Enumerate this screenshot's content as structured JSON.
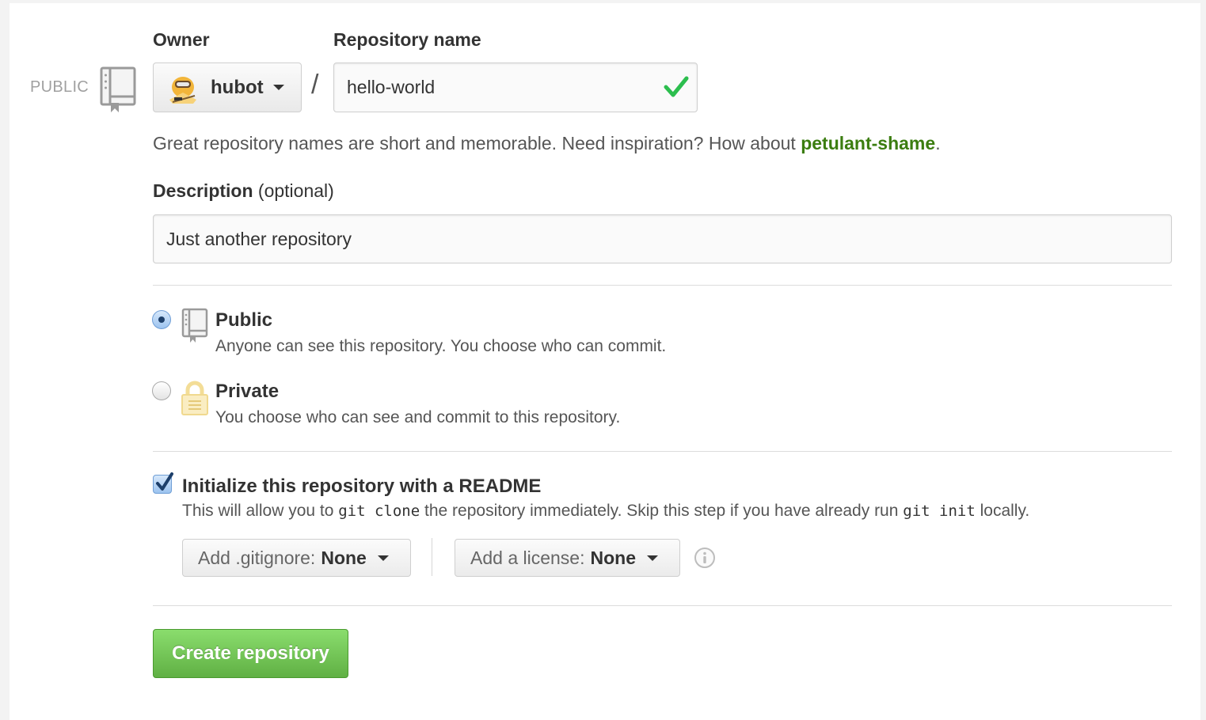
{
  "visibility_indicator": {
    "label": "PUBLIC"
  },
  "owner": {
    "label": "Owner",
    "selected": "hubot"
  },
  "separator": "/",
  "repository_name": {
    "label": "Repository name",
    "value": "hello-world"
  },
  "name_hint": {
    "text": "Great repository names are short and memorable. Need inspiration? How about ",
    "suggestion": "petulant-shame",
    "end": "."
  },
  "description": {
    "label": "Description",
    "optional": "(optional)",
    "value": "Just another repository"
  },
  "visibility_options": [
    {
      "title": "Public",
      "description": "Anyone can see this repository. You choose who can commit.",
      "checked": true
    },
    {
      "title": "Private",
      "description": "You choose who can see and commit to this repository.",
      "checked": false
    }
  ],
  "readme": {
    "title": "Initialize this repository with a README",
    "desc_part1": "This will allow you to ",
    "code1": "git clone",
    "desc_part2": " the repository immediately. Skip this step if you have already run ",
    "code2": "git init",
    "desc_part3": " locally.",
    "checked": true
  },
  "gitignore": {
    "prefix": "Add .gitignore:",
    "value": "None"
  },
  "license": {
    "prefix": "Add a license:",
    "value": "None"
  },
  "create_button": {
    "label": "Create repository"
  },
  "colors": {
    "accent_green": "#3b7d10",
    "button_green": "#60b044",
    "check_green": "#2cbe4e",
    "radio_blue": "#6f9ed6"
  },
  "icons": [
    "repo-icon",
    "hubot-avatar",
    "checkmark-icon",
    "lock-icon",
    "info-icon",
    "caret-down-icon"
  ]
}
